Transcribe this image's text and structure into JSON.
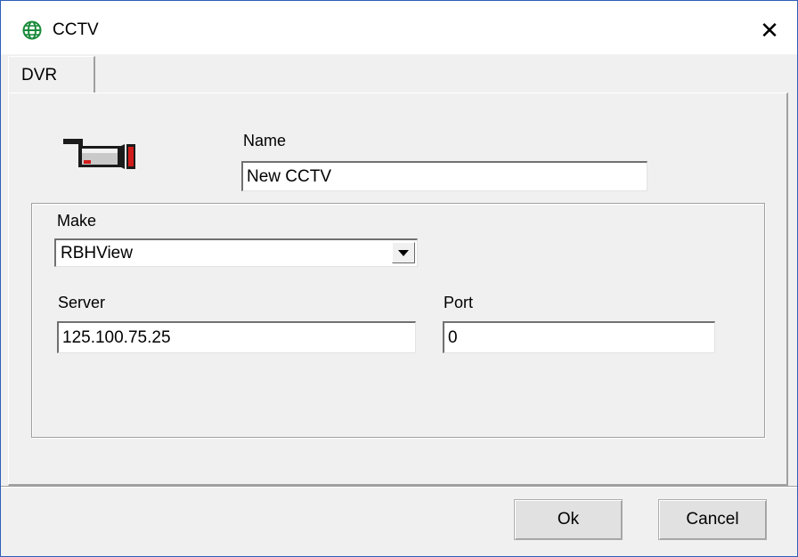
{
  "window": {
    "title": "CCTV",
    "title_icon": "globe-icon",
    "close_glyph": "✕"
  },
  "tabs": [
    {
      "label": "DVR",
      "selected": true
    }
  ],
  "form": {
    "camera_icon": "cctv-camera-icon",
    "name_label": "Name",
    "name_value": "New CCTV",
    "make_label": "Make",
    "make_value": "RBHView",
    "server_label": "Server",
    "server_value": "125.100.75.25",
    "port_label": "Port",
    "port_value": "0"
  },
  "buttons": {
    "ok_label": "Ok",
    "cancel_label": "Cancel"
  },
  "colors": {
    "accent_border": "#2f5fb7",
    "face": "#f0f0f0",
    "icon_red": "#d21c1c",
    "icon_green": "#1a8a3a"
  }
}
